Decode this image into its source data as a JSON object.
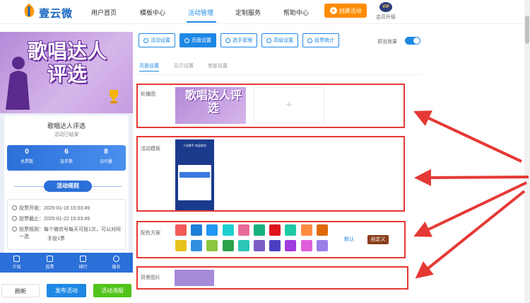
{
  "nav": {
    "brand": "壹云微",
    "items": [
      "用户首页",
      "模板中心",
      "活动管理",
      "定制服务",
      "帮助中心"
    ],
    "active_index": 2,
    "create_label": "创建活动",
    "vip_badge": "VIP",
    "vip_label": "会员升级"
  },
  "preview": {
    "banner_title": "歌唱达人评选",
    "card_title": "歌唱达人评选",
    "status": "活动已结束",
    "stats": [
      {
        "value": "0",
        "label": "总票数"
      },
      {
        "value": "6",
        "label": "选手数"
      },
      {
        "value": "8",
        "label": "访问量"
      }
    ],
    "rules_button": "活动规则",
    "info": {
      "start": "投票开始：2025-01-16 15:03:49",
      "end": "投票截止：2025-01-22 15:03:49",
      "rule_line1": "投票规则：每个微信号每天可投1次，可以对同一选",
      "rule_line2": "手投1票"
    },
    "tabs": [
      "介绍",
      "投票",
      "排行",
      "报名"
    ]
  },
  "actions": {
    "refresh": "刷新",
    "publish": "发布活动",
    "preview": "活动海报"
  },
  "toolbar": {
    "buttons": [
      "活动设置",
      "页面设置",
      "选手管理",
      "高级设置",
      "投票统计"
    ],
    "active_index": 1,
    "preview_toggle_label": "预览效果"
  },
  "subtabs": [
    "页面设置",
    "显示设置",
    "底部设置"
  ],
  "sections": {
    "carousel_label": "轮播图",
    "carousel_banner_text": "歌唱达人评选",
    "upload_plus": "+",
    "template_label": "活动模板",
    "template_title": "十佳歌手 欢迎参加",
    "color_label": "配色方案",
    "color_default": "默认",
    "color_custom": "自定义",
    "bg_label": "背景图片",
    "bg_color": "#a58ad8"
  },
  "colors": {
    "row1": [
      "#f25a5a",
      "#1e7fd6",
      "#2196f3",
      "#1ecfd0",
      "#e96a9a",
      "#18b07a",
      "#e0141e",
      "#20c9a5",
      "#ff8c42",
      "#e06a0a"
    ],
    "row2": [
      "#e6c21a",
      "#2f8fe0",
      "#8cc63f",
      "#2ca24a",
      "#2cc7b8",
      "#7a5cc6",
      "#4a3fc1",
      "#a13ce0",
      "#e05fd9",
      "#9b7fe8"
    ],
    "accent": "#1e88e5",
    "annotation": "#e53935"
  }
}
